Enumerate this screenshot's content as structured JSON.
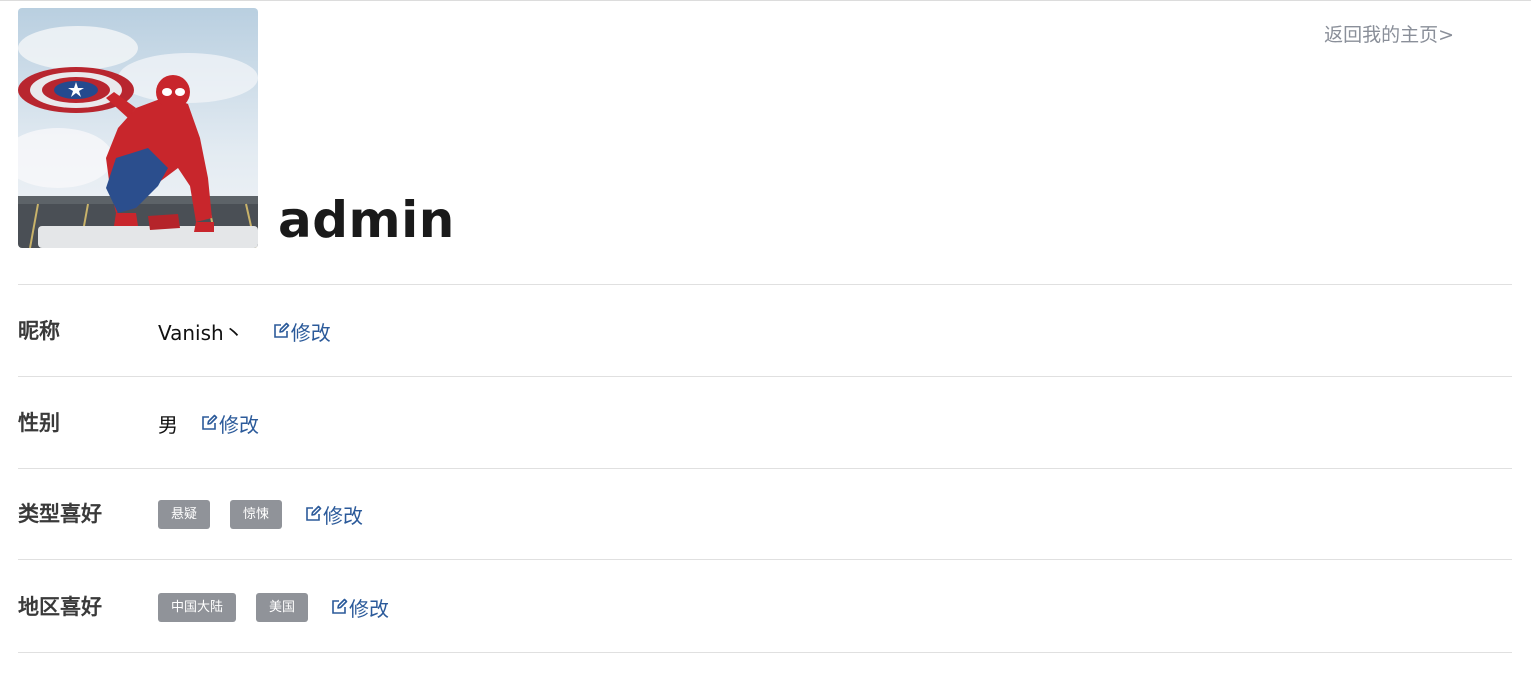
{
  "profile": {
    "username": "admin",
    "back_link": "返回我的主页>"
  },
  "fields": {
    "nickname": {
      "label": "昵称",
      "value": "Vanish丶",
      "edit": "修改"
    },
    "gender": {
      "label": "性别",
      "value": "男",
      "edit": "修改"
    },
    "genre_pref": {
      "label": "类型喜好",
      "tags": [
        "悬疑",
        "惊悚"
      ],
      "edit": "修改"
    },
    "region_pref": {
      "label": "地区喜好",
      "tags": [
        "中国大陆",
        "美国"
      ],
      "edit": "修改"
    }
  },
  "colors": {
    "tag_bg": "#909399",
    "edit_link": "#2b5a9a",
    "back_link": "#8a8f99"
  },
  "icons": {
    "edit": "edit-icon"
  }
}
